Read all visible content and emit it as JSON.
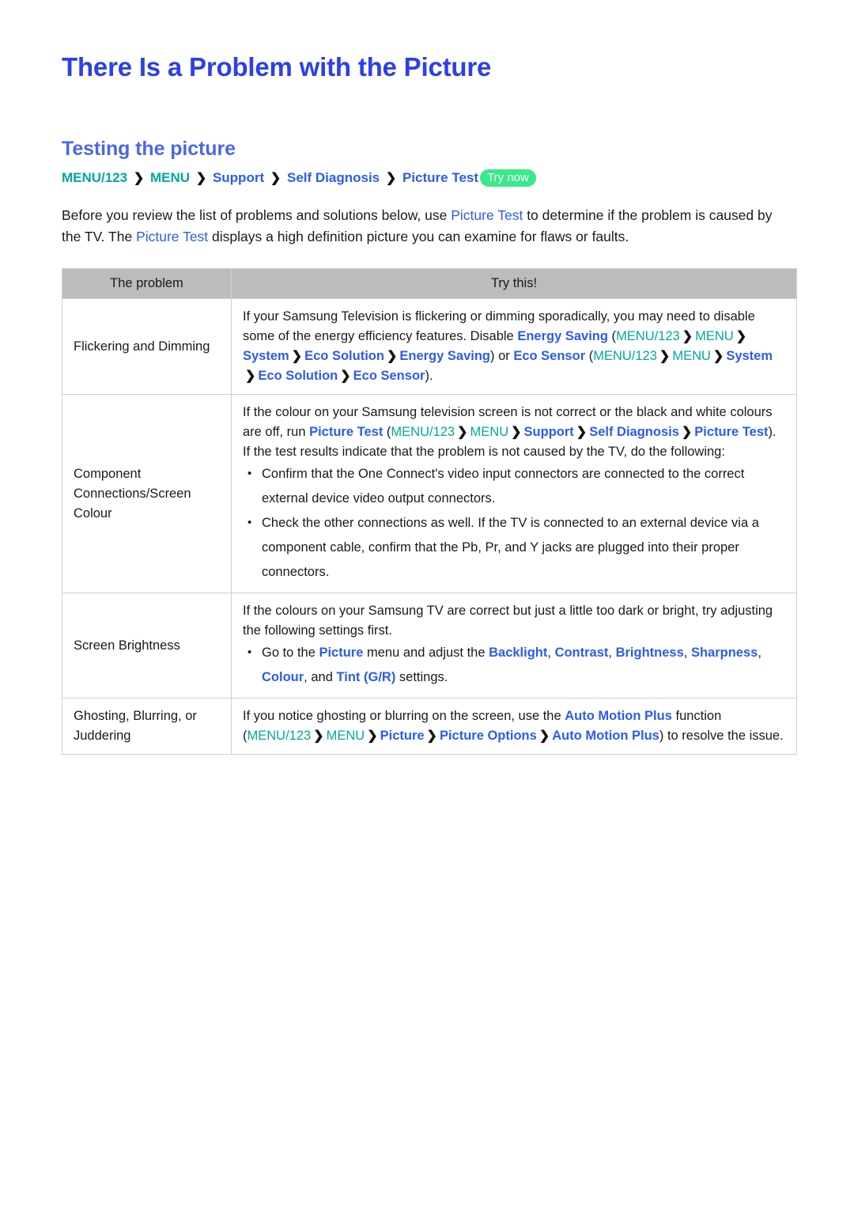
{
  "document": {
    "title": "There Is a Problem with the Picture",
    "section_title": "Testing the picture"
  },
  "breadcrumb": {
    "items": [
      {
        "label": "MENU/123",
        "color": "teal"
      },
      {
        "label": "MENU",
        "color": "teal"
      },
      {
        "label": "Support",
        "color": "blue"
      },
      {
        "label": "Self Diagnosis",
        "color": "blue"
      },
      {
        "label": "Picture Test",
        "color": "blue"
      }
    ],
    "separator": "❯",
    "badge": "Try now"
  },
  "intro": {
    "part1": "Before you review the list of problems and solutions below, use ",
    "link1": "Picture Test",
    "part2": " to determine if the problem is caused by the TV. The ",
    "link2": "Picture Test",
    "part3": " displays a high definition picture you can examine for flaws or faults."
  },
  "table": {
    "headers": {
      "problem": "The problem",
      "try": "Try this!"
    },
    "rows": [
      {
        "problem": "Flickering and Dimming",
        "text_a": "If your Samsung Television is flickering or dimming sporadically, you may need to disable some of the energy efficiency features. Disable ",
        "link_energy_saving": "Energy Saving",
        "open_paren": " (",
        "path1": [
          "MENU/123",
          "MENU",
          "System",
          "Eco Solution",
          "Energy Saving"
        ],
        "mid": ") or ",
        "link_eco_sensor": "Eco Sensor",
        "path2": [
          "MENU/123",
          "MENU",
          "System",
          "Eco Solution",
          "Eco Sensor"
        ],
        "close": ")."
      },
      {
        "problem": "Component Connections/Screen Colour",
        "text_a": "If the colour on your Samsung television screen is not correct or the black and white colours are off, run ",
        "link_picture_test": "Picture Test",
        "open_paren": " (",
        "path1": [
          "MENU/123",
          "MENU",
          "Support",
          "Self Diagnosis",
          "Picture Test"
        ],
        "close": ").",
        "text_b": "If the test results indicate that the problem is not caused by the TV, do the following:",
        "bullets": [
          "Confirm that the One Connect's video input connectors are connected to the correct external device video output connectors.",
          "Check the other connections as well. If the TV is connected to an external device via a component cable, confirm that the Pb, Pr, and Y jacks are plugged into their proper connectors."
        ]
      },
      {
        "problem": "Screen Brightness",
        "text_a": "If the colours on your Samsung TV are correct but just a little too dark or bright, try adjusting the following settings first.",
        "bullet_lead": "Go to the ",
        "link_picture": "Picture",
        "bullet_mid": " menu and adjust the ",
        "settings": [
          "Backlight",
          "Contrast",
          "Brightness",
          "Sharpness",
          "Colour",
          "Tint (G/R)"
        ],
        "bullet_tail": " settings."
      },
      {
        "problem": "Ghosting, Blurring, or Juddering",
        "text_a": "If you notice ghosting or blurring on the screen, use the ",
        "link_amp": "Auto Motion Plus",
        "text_b": " function (",
        "path1": [
          "MENU/123",
          "MENU",
          "Picture",
          "Picture Options",
          "Auto Motion Plus"
        ],
        "text_c": ") to resolve the issue."
      }
    ]
  }
}
